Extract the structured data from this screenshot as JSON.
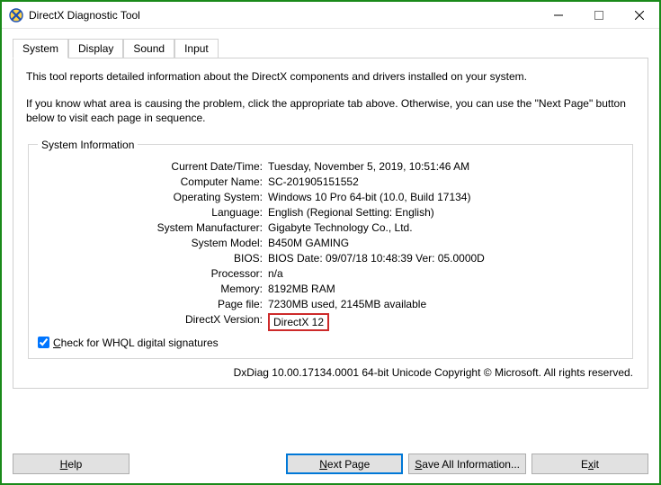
{
  "window": {
    "title": "DirectX Diagnostic Tool"
  },
  "tabs": [
    "System",
    "Display",
    "Sound",
    "Input"
  ],
  "activeTabIndex": 0,
  "intro": {
    "line1": "This tool reports detailed information about the DirectX components and drivers installed on your system.",
    "line2": "If you know what area is causing the problem, click the appropriate tab above.  Otherwise, you can use the \"Next Page\" button below to visit each page in sequence."
  },
  "systemInfo": {
    "legend": "System Information",
    "rows": [
      {
        "label": "Current Date/Time:",
        "value": "Tuesday, November 5, 2019, 10:51:46 AM"
      },
      {
        "label": "Computer Name:",
        "value": "SC-201905151552"
      },
      {
        "label": "Operating System:",
        "value": "Windows 10 Pro 64-bit (10.0, Build 17134)"
      },
      {
        "label": "Language:",
        "value": "English (Regional Setting: English)"
      },
      {
        "label": "System Manufacturer:",
        "value": "Gigabyte Technology Co., Ltd."
      },
      {
        "label": "System Model:",
        "value": "B450M GAMING"
      },
      {
        "label": "BIOS:",
        "value": "BIOS Date: 09/07/18 10:48:39 Ver: 05.0000D"
      },
      {
        "label": "Processor:",
        "value": "n/a"
      },
      {
        "label": "Memory:",
        "value": "8192MB RAM"
      },
      {
        "label": "Page file:",
        "value": "7230MB used, 2145MB available"
      },
      {
        "label": "DirectX Version:",
        "value": "DirectX 12",
        "highlight": true
      }
    ]
  },
  "whql": {
    "checked": true,
    "prefix": "C",
    "rest": "heck for WHQL digital signatures"
  },
  "footer": "DxDiag 10.00.17134.0001 64-bit Unicode  Copyright © Microsoft. All rights reserved.",
  "buttons": {
    "help": {
      "underline": "H",
      "rest": "elp"
    },
    "next": {
      "underline": "N",
      "rest": "ext Page"
    },
    "save": {
      "underline": "S",
      "rest": "ave All Information..."
    },
    "exit": {
      "prefix": "E",
      "underline": "x",
      "suffix": "it"
    }
  }
}
